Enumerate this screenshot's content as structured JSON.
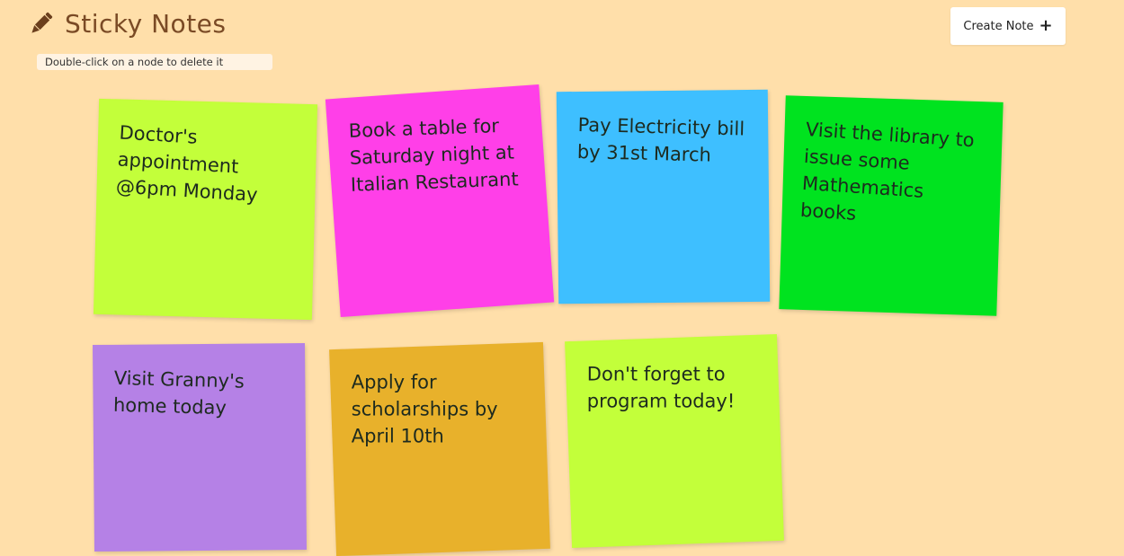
{
  "app": {
    "title": "Sticky Notes",
    "hint": "Double-click on a node to delete it",
    "create_label": "Create Note",
    "create_icon": "plus-icon",
    "title_icon": "pencil-icon"
  },
  "notes": [
    {
      "text": "Doctor's appointment @6pm Monday",
      "color": "#c3ff3a"
    },
    {
      "text": "Book a table for Saturday night at Italian Restaurant",
      "color": "#ff3fe8"
    },
    {
      "text": "Pay Electricity bill by 31st March",
      "color": "#3ebfff"
    },
    {
      "text": "Visit the library to issue some Mathematics books",
      "color": "#00e31f"
    },
    {
      "text": "Visit Granny's home today",
      "color": "#b581e6"
    },
    {
      "text": "Apply for scholarships by April 10th",
      "color": "#e8b12b"
    },
    {
      "text": "Don't forget to program today!",
      "color": "#c3ff3a"
    }
  ]
}
